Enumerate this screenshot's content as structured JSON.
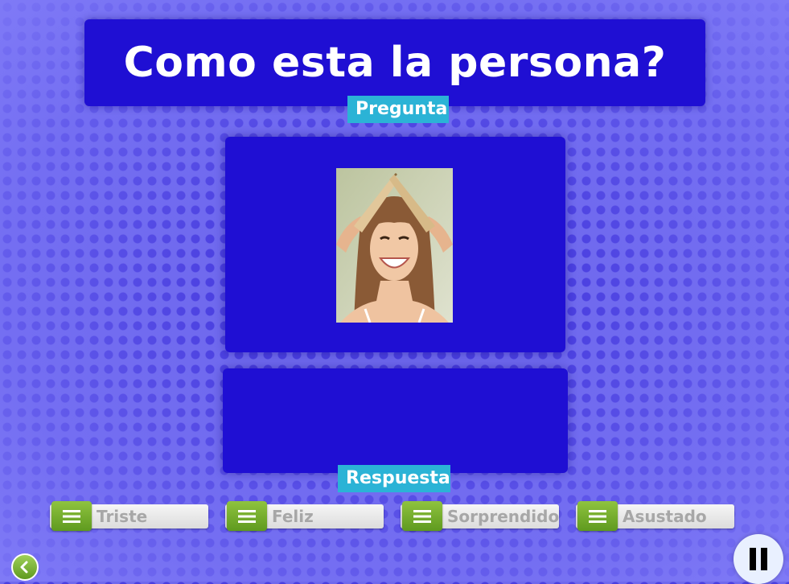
{
  "title": "Como esta la persona?",
  "question_tag": "Pregunta",
  "answer_tag": "Respuesta",
  "question_image": "smiling woman with book on head",
  "options": [
    {
      "label": "Triste"
    },
    {
      "label": "Feliz"
    },
    {
      "label": "Sorprendido"
    },
    {
      "label": "Asustado"
    }
  ],
  "icons": {
    "back": "chevron-left-icon",
    "pause": "pause-icon",
    "drag": "drag-handle-icon"
  },
  "colors": {
    "panel": "#1f0fd3",
    "tag": "#2bb3d6",
    "handle": "#6aa82a",
    "background": "#6f69ee"
  }
}
